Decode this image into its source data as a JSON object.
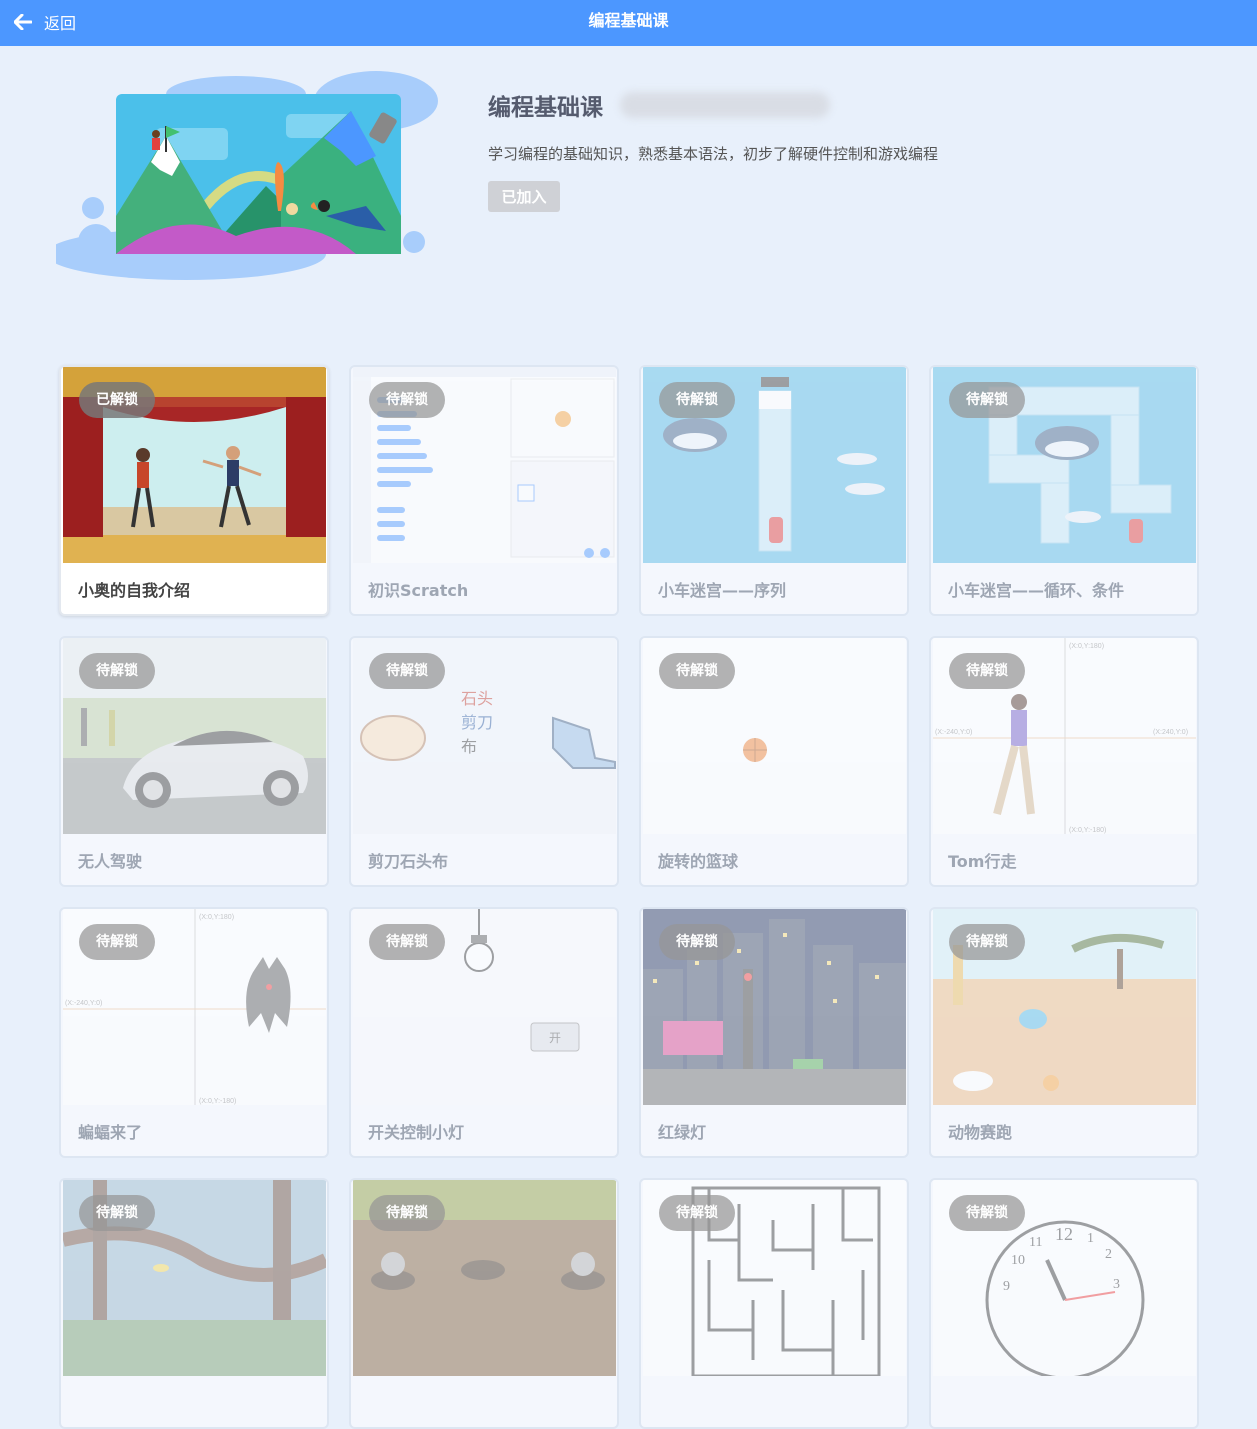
{
  "header": {
    "back_label": "返回",
    "title": "编程基础课"
  },
  "course": {
    "title": "编程基础课",
    "description": "学习编程的基础知识，熟悉基本语法，初步了解硬件控制和游戏编程",
    "joined_label": "已加入"
  },
  "lessons": [
    {
      "title": "小奥的自我介绍",
      "badge": "已解锁",
      "status": "unlocked"
    },
    {
      "title": "初识Scratch",
      "badge": "待解锁",
      "status": "locked"
    },
    {
      "title": "小车迷宫——序列",
      "badge": "待解锁",
      "status": "locked"
    },
    {
      "title": "小车迷宫——循环、条件",
      "badge": "待解锁",
      "status": "locked"
    },
    {
      "title": "无人驾驶",
      "badge": "待解锁",
      "status": "locked"
    },
    {
      "title": "剪刀石头布",
      "badge": "待解锁",
      "status": "locked",
      "thumb_text": [
        "石头",
        "剪刀",
        "布"
      ]
    },
    {
      "title": "旋转的篮球",
      "badge": "待解锁",
      "status": "locked"
    },
    {
      "title": "Tom行走",
      "badge": "待解锁",
      "status": "locked"
    },
    {
      "title": "蝙蝠来了",
      "badge": "待解锁",
      "status": "locked"
    },
    {
      "title": "开关控制小灯",
      "badge": "待解锁",
      "status": "locked",
      "thumb_text": [
        "开"
      ]
    },
    {
      "title": "红绿灯",
      "badge": "待解锁",
      "status": "locked"
    },
    {
      "title": "动物赛跑",
      "badge": "待解锁",
      "status": "locked"
    },
    {
      "title": "",
      "badge": "待解锁",
      "status": "locked"
    },
    {
      "title": "",
      "badge": "待解锁",
      "status": "locked"
    },
    {
      "title": "",
      "badge": "待解锁",
      "status": "locked"
    },
    {
      "title": "",
      "badge": "待解锁",
      "status": "locked"
    }
  ],
  "colors": {
    "header_bg": "#4c97ff",
    "page_bg": "#e8f0fb"
  }
}
